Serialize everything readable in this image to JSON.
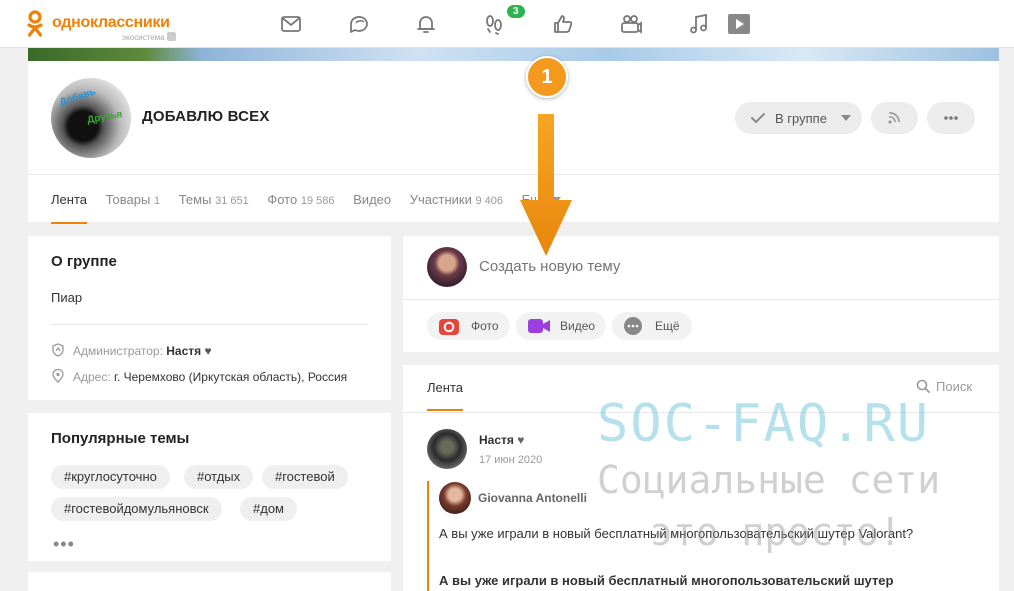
{
  "topbar": {
    "brand": "одноклассники",
    "brand_sub": "экосистема",
    "notifications_badge": "3",
    "icons": [
      "mail-icon",
      "chat-icon",
      "bell-icon",
      "guests-icon",
      "like-icon",
      "gift-icon",
      "music-icon",
      "video-icon"
    ]
  },
  "group": {
    "title": "ДОБАВЛЮ ВСЕХ",
    "avatar_text1": "Добавь",
    "avatar_text2": "Друзья",
    "in_group_label": "В группе",
    "tabs": [
      {
        "label": "Лента",
        "count": ""
      },
      {
        "label": "Товары",
        "count": "1"
      },
      {
        "label": "Темы",
        "count": "31 651"
      },
      {
        "label": "Фото",
        "count": "19 586"
      },
      {
        "label": "Видео",
        "count": ""
      },
      {
        "label": "Участники",
        "count": "9 406"
      },
      {
        "label": "Еще",
        "count": ""
      }
    ]
  },
  "about": {
    "heading": "О группе",
    "description": "Пиар",
    "admin_label": "Администратор:",
    "admin_name": "Настя",
    "address_label": "Адрес:",
    "address_value": "г. Черемхово (Иркутская область), Россия"
  },
  "popular": {
    "heading": "Популярные темы",
    "tags": [
      "#круглосуточно",
      "#отдых",
      "#гостевой",
      "#гостевойдомульяновск",
      "#дом"
    ],
    "more": "•••"
  },
  "composer": {
    "placeholder": "Создать новую тему",
    "photo": "Фото",
    "video": "Видео",
    "more": "Ещё"
  },
  "feed": {
    "tab": "Лента",
    "search": "Поиск",
    "post": {
      "author": "Настя",
      "date": "17 июн 2020",
      "repost_author": "Giovanna Antonelli",
      "text": "А вы уже играли в новый бесплатный многопользовательский шутер Valorant?",
      "text_bold": "А вы уже играли в новый бесплатный многопользовательский шутер"
    }
  },
  "annotation": {
    "step": "1"
  },
  "watermark": {
    "line1": "SOC-FAQ.RU",
    "line2": "Социальные сети",
    "line3": "это просто!"
  },
  "colors": {
    "accent": "#ee8208",
    "annotation": "#f39a1e",
    "badge": "#2eb44f"
  }
}
